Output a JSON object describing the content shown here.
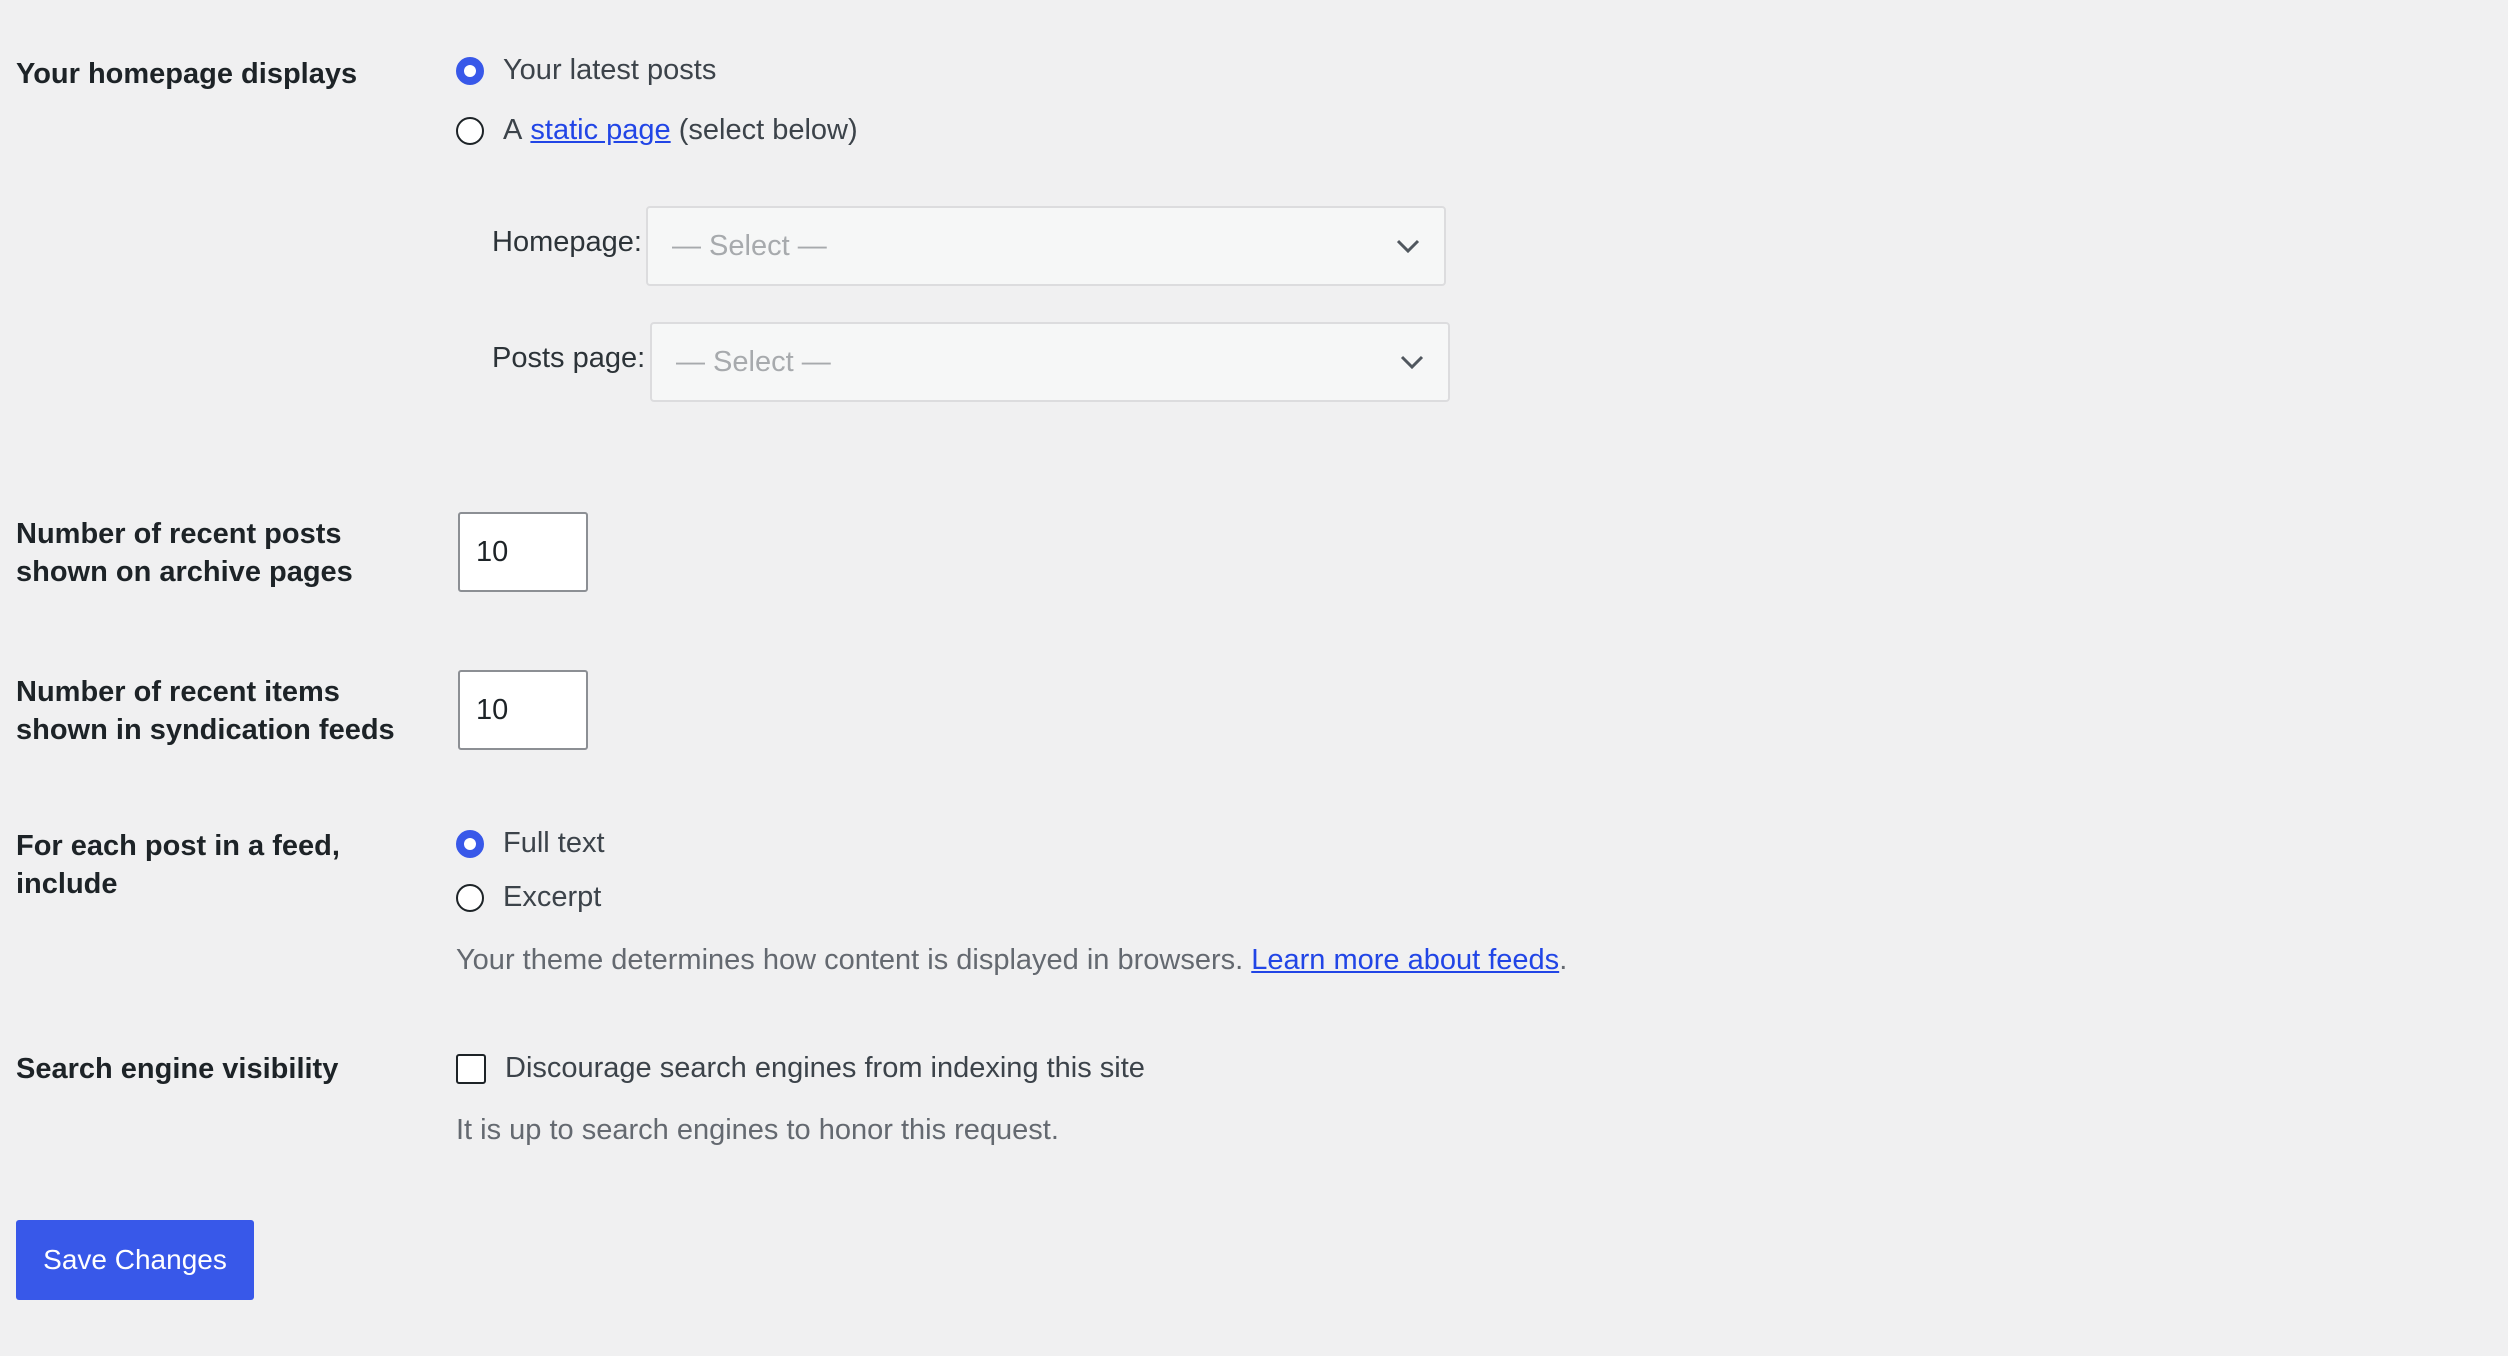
{
  "homepage_displays": {
    "label": "Your homepage displays",
    "options": [
      {
        "label": "Your latest posts",
        "checked": true
      },
      {
        "prefix": "A",
        "link_text": "static page",
        "suffix": "(select below)",
        "checked": false
      }
    ],
    "homepage_label": "Homepage:",
    "homepage_select": "— Select —",
    "posts_page_label": "Posts page:",
    "posts_page_select": "— Select —"
  },
  "archive_posts": {
    "label": "Number of recent posts shown on archive pages",
    "value": "10"
  },
  "feed_items": {
    "label": "Number of recent items shown in syndication feeds",
    "value": "10"
  },
  "feed_content": {
    "label": "For each post in a feed, include",
    "options": [
      {
        "label": "Full text",
        "checked": true
      },
      {
        "label": "Excerpt",
        "checked": false
      }
    ],
    "description": "Your theme determines how content is displayed in browsers.",
    "link_text": "Learn more about feeds",
    "link_suffix": "."
  },
  "search_visibility": {
    "label": "Search engine visibility",
    "checkbox_label": "Discourage search engines from indexing this site",
    "checked": false,
    "description": "It is up to search engines to honor this request."
  },
  "save_button": "Save Changes",
  "colors": {
    "accent": "#3858e9",
    "link": "#2145e6",
    "background": "#f0f0f1"
  }
}
